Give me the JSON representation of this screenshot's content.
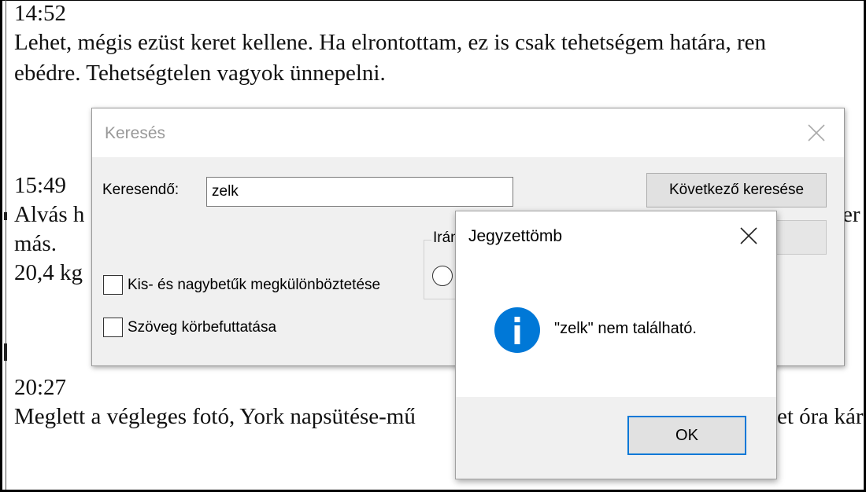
{
  "document": {
    "lines": [
      "14:52",
      "Lehet, mégis ezüst keret kellene. Ha elrontottam, ez is csak tehetségem határa, ren",
      "ebédre. Tehetségtelen vagyok ünnepelni.",
      "15:49",
      "Alvás h",
      "er",
      "más.",
      "20,4 kg",
      "20:27",
      "Meglett a végleges fotó, York napsütése-mű",
      "et óra kár"
    ]
  },
  "find_dialog": {
    "title": "Keresés",
    "search_label": "Keresendő:",
    "search_value": "zelk",
    "find_next_label": "Következő keresése",
    "direction_label": "Irán",
    "match_case_label": "Kis- és nagybetűk megkülönböztetése",
    "wrap_around_label": "Szöveg körbefuttatása"
  },
  "message_box": {
    "title": "Jegyzettömb",
    "message": "\"zelk\" nem található.",
    "ok_label": "OK"
  },
  "icons": {
    "info": "info-icon",
    "close": "close-icon"
  },
  "colors": {
    "info_icon": "#0078d7",
    "focus_border": "#0078d7",
    "dialog_bg": "#f0f0f0"
  }
}
